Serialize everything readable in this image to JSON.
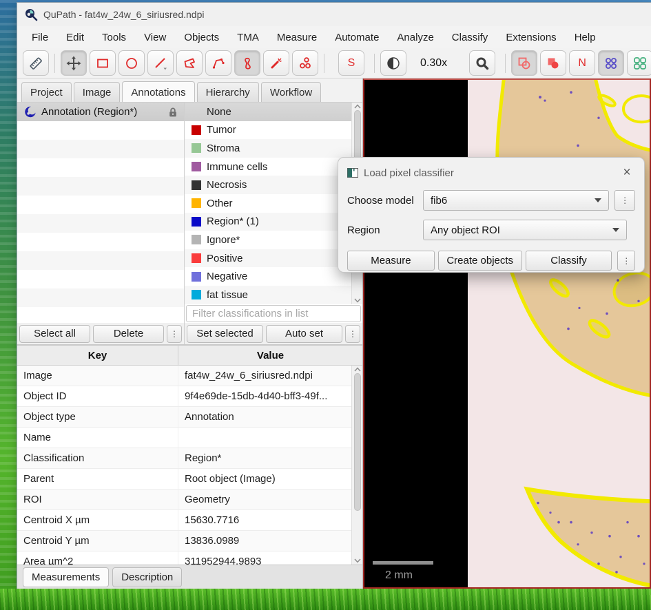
{
  "titlebar": {
    "title": "QuPath - fat4w_24w_6_siriusred.ndpi"
  },
  "menu": {
    "items": [
      "File",
      "Edit",
      "Tools",
      "View",
      "Objects",
      "TMA",
      "Measure",
      "Automate",
      "Analyze",
      "Classify",
      "Extensions",
      "Help"
    ]
  },
  "toolbar": {
    "magnification": "0.30x",
    "selection_mode_label": "S",
    "names_label": "N"
  },
  "panel_tabs": {
    "items": [
      "Project",
      "Image",
      "Annotations",
      "Hierarchy",
      "Workflow"
    ],
    "selected": "Annotations"
  },
  "annotation_list": {
    "selected_item": "Annotation (Region*)"
  },
  "classifications": {
    "items": [
      {
        "label": "None",
        "color": null
      },
      {
        "label": "Tumor",
        "color": "#c80000"
      },
      {
        "label": "Stroma",
        "color": "#96c795"
      },
      {
        "label": "Immune cells",
        "color": "#a05aa0"
      },
      {
        "label": "Necrosis",
        "color": "#323232"
      },
      {
        "label": "Other",
        "color": "#ffb400"
      },
      {
        "label": "Region* (1)",
        "color": "#0a0ac8"
      },
      {
        "label": "Ignore*",
        "color": "#b4b4b4"
      },
      {
        "label": "Positive",
        "color": "#fa3c3c"
      },
      {
        "label": "Negative",
        "color": "#7070dc"
      },
      {
        "label": "fat tissue",
        "color": "#00aadc"
      }
    ]
  },
  "filter": {
    "placeholder": "Filter classifications in list"
  },
  "actions": {
    "select_all": "Select all",
    "delete": "Delete",
    "set_selected": "Set selected",
    "auto_set": "Auto set",
    "more": "⋮"
  },
  "measurements": {
    "columns": {
      "key": "Key",
      "value": "Value"
    },
    "rows": [
      {
        "key": "Image",
        "value": "fat4w_24w_6_siriusred.ndpi"
      },
      {
        "key": "Object ID",
        "value": "9f4e69de-15db-4d40-bff3-49f..."
      },
      {
        "key": "Object type",
        "value": "Annotation"
      },
      {
        "key": "Name",
        "value": ""
      },
      {
        "key": "Classification",
        "value": "Region*"
      },
      {
        "key": "Parent",
        "value": "Root object (Image)"
      },
      {
        "key": "ROI",
        "value": "Geometry"
      },
      {
        "key": "Centroid X µm",
        "value": "15630.7716"
      },
      {
        "key": "Centroid Y µm",
        "value": "13836.0989"
      },
      {
        "key": "Area µm^2",
        "value": "311952944.9893"
      }
    ]
  },
  "bottom_tabs": {
    "items": [
      "Measurements",
      "Description"
    ],
    "selected": "Measurements"
  },
  "dialog": {
    "title": "Load pixel classifier",
    "model_label": "Choose model",
    "model_value": "fib6",
    "region_label": "Region",
    "region_value": "Any object ROI",
    "measure_button": "Measure",
    "create_objects_button": "Create objects",
    "classify_button": "Classify",
    "more_button": "⋮"
  },
  "viewer": {
    "scale_bar_label": "2 mm"
  }
}
